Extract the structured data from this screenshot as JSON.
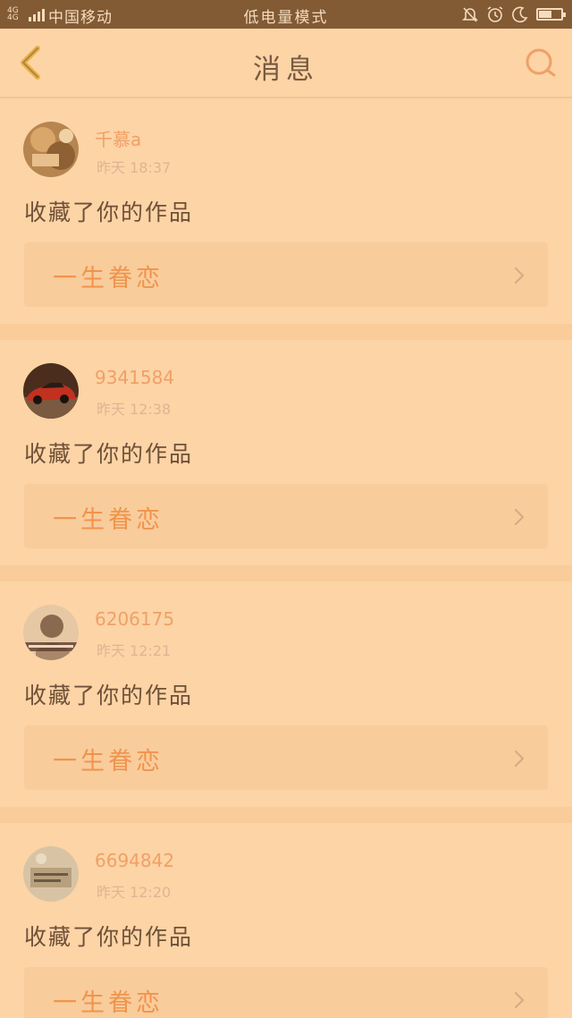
{
  "status_bar": {
    "network": "4G 4G",
    "carrier": "中国移动",
    "mode": "低电量模式",
    "battery_level": 0.62,
    "icons": [
      "signal-icon",
      "bell-muted-icon",
      "alarm-icon",
      "moon-icon",
      "battery-icon"
    ]
  },
  "header": {
    "title": "消息",
    "back_icon": "chevron-left-icon",
    "search_icon": "search-icon"
  },
  "colors": {
    "background": "#fcd4a6",
    "status_bar": "#825a34",
    "accent": "#f0944c",
    "username": "#f0a066",
    "text": "#6f5038"
  },
  "messages": [
    {
      "user": "千慕a",
      "time": "昨天 18:37",
      "action": "收藏了你的作品",
      "work": "一生眷恋"
    },
    {
      "user": "9341584",
      "time": "昨天 12:38",
      "action": "收藏了你的作品",
      "work": "一生眷恋"
    },
    {
      "user": "6206175",
      "time": "昨天 12:21",
      "action": "收藏了你的作品",
      "work": "一生眷恋"
    },
    {
      "user": "6694842",
      "time": "昨天 12:20",
      "action": "收藏了你的作品",
      "work": "一生眷恋"
    }
  ]
}
